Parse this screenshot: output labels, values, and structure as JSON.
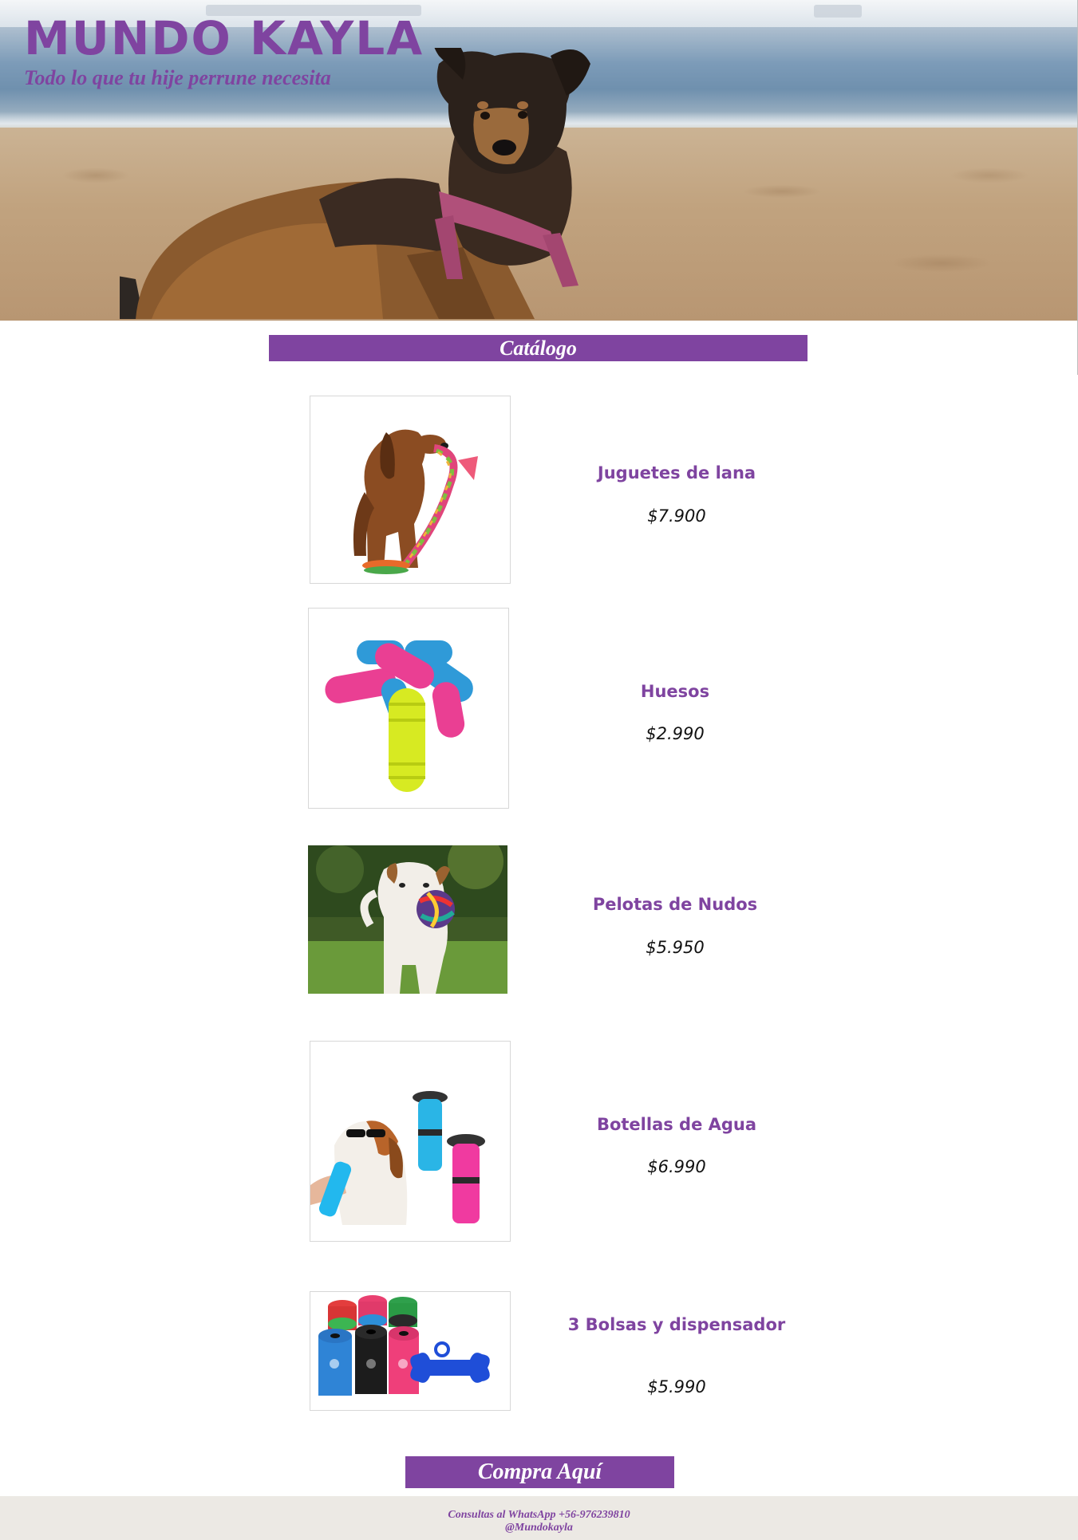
{
  "header": {
    "title": "MUNDO KAYLA",
    "subtitle": "Todo lo que tu hije perrune necesita"
  },
  "catalog": {
    "heading": "Catálogo",
    "products": [
      {
        "name": "Juguetes de lana",
        "price": "$7.900"
      },
      {
        "name": "Huesos",
        "price": "$2.990"
      },
      {
        "name": "Pelotas de Nudos",
        "price": "$5.950"
      },
      {
        "name": "Botellas de Agua",
        "price": "$6.990"
      },
      {
        "name": "3 Bolsas y dispensador",
        "price": "$5.990"
      }
    ]
  },
  "buy": {
    "label": "Compra Aquí"
  },
  "footer": {
    "line1": "Consultas al WhatsApp +56-976239810",
    "line2": "@Mundokayla"
  },
  "colors": {
    "accent": "#7f44a0",
    "footer_bg": "#ece9e4"
  }
}
